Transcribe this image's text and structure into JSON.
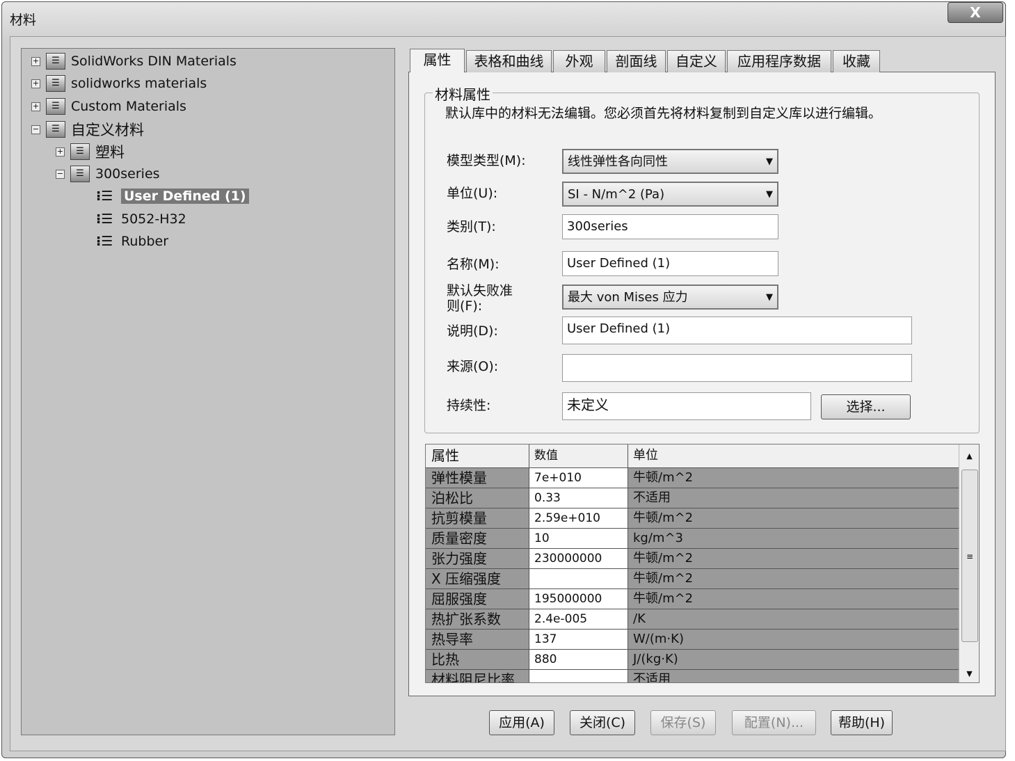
{
  "window": {
    "title": "材料",
    "close": "X"
  },
  "tree": [
    {
      "label": "SolidWorks DIN Materials",
      "exp": "+"
    },
    {
      "label": "solidworks materials",
      "exp": "+"
    },
    {
      "label": "Custom Materials",
      "exp": "+"
    },
    {
      "label": "自定义材料",
      "exp": "−"
    },
    {
      "label": "塑料",
      "exp": "+"
    },
    {
      "label": "300series",
      "exp": "−"
    },
    {
      "label": "User Defined (1)"
    },
    {
      "label": "5052-H32"
    },
    {
      "label": "Rubber"
    }
  ],
  "tabs": [
    "属性",
    "表格和曲线",
    "外观",
    "剖面线",
    "自定义",
    "应用程序数据",
    "收藏"
  ],
  "group": {
    "title": "材料属性",
    "note": "默认库中的材料无法编辑。您必须首先将材料复制到自定义库以进行编辑。"
  },
  "form": {
    "model_type_label": "模型类型(M):",
    "model_type": "线性弹性各向同性",
    "units_label": "单位(U):",
    "units": "SI - N/m^2 (Pa)",
    "category_label": "类别(T):",
    "category": "300series",
    "name_label": "名称(M):",
    "name": "User Defined (1)",
    "failure_label": "默认失败准则(F):",
    "failure": "最大 von Mises 应力",
    "desc_label": "说明(D):",
    "desc": "User Defined (1)",
    "source_label": "来源(O):",
    "source": "",
    "sustain_label": "持续性:",
    "sustain": "未定义",
    "select_btn": "选择..."
  },
  "table": {
    "headers": [
      "属性",
      "数值",
      "单位"
    ],
    "rows": [
      [
        "弹性模量",
        "7e+010",
        "牛顿/m^2"
      ],
      [
        "泊松比",
        "0.33",
        "不适用"
      ],
      [
        "抗剪模量",
        "2.59e+010",
        "牛顿/m^2"
      ],
      [
        "质量密度",
        "10",
        "kg/m^3"
      ],
      [
        "张力强度",
        "230000000",
        "牛顿/m^2"
      ],
      [
        "X 压缩强度",
        "",
        "牛顿/m^2"
      ],
      [
        "屈服强度",
        "195000000",
        "牛顿/m^2"
      ],
      [
        "热扩张系数",
        "2.4e-005",
        "/K"
      ],
      [
        "热导率",
        "137",
        "W/(m·K)"
      ],
      [
        "比热",
        "880",
        "J/(kg·K)"
      ],
      [
        "材料阻尼比率",
        "",
        "不适用"
      ]
    ]
  },
  "buttons": {
    "apply": "应用(A)",
    "close": "关闭(C)",
    "save": "保存(S)",
    "config": "配置(N)...",
    "help": "帮助(H)"
  }
}
